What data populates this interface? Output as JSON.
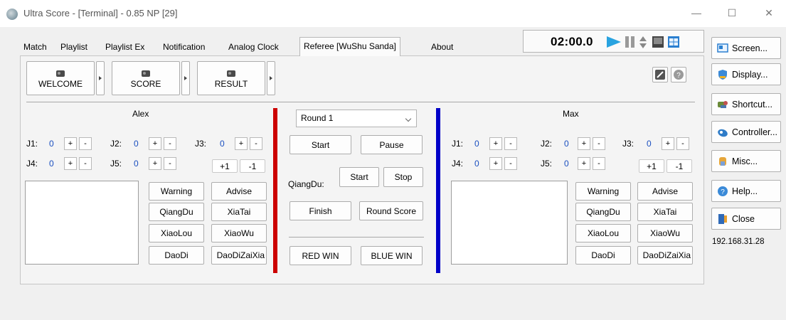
{
  "window": {
    "title": "Ultra Score - [Terminal] - 0.85 NP [29]",
    "minimize": "—",
    "maximize": "☐",
    "close": "✕"
  },
  "tabs": [
    "Match",
    "Playlist",
    "Playlist Ex",
    "Notification",
    "Analog Clock",
    "Referee [WuShu Sanda]",
    "About"
  ],
  "active_tab": "Referee [WuShu Sanda]",
  "timer": {
    "time": "02:00.0"
  },
  "top_buttons": {
    "welcome": "WELCOME",
    "score": "SCORE",
    "result": "RESULT"
  },
  "red": {
    "name": "Alex",
    "judges": [
      {
        "label": "J1:",
        "value": "0"
      },
      {
        "label": "J2:",
        "value": "0"
      },
      {
        "label": "J3:",
        "value": "0"
      },
      {
        "label": "J4:",
        "value": "0"
      },
      {
        "label": "J5:",
        "value": "0"
      }
    ],
    "plus_label": "+",
    "minus_label": "-",
    "plus_one": "+1",
    "minus_one": "-1",
    "actions": {
      "warning": "Warning",
      "advise": "Advise",
      "qiangdu": "QiangDu",
      "xiatai": "XiaTai",
      "xiaolou": "XiaoLou",
      "xiaowu": "XiaoWu",
      "daodi": "DaoDi",
      "daodizaixia": "DaoDiZaiXia"
    }
  },
  "blue": {
    "name": "Max",
    "judges": [
      {
        "label": "J1:",
        "value": "0"
      },
      {
        "label": "J2:",
        "value": "0"
      },
      {
        "label": "J3:",
        "value": "0"
      },
      {
        "label": "J4:",
        "value": "0"
      },
      {
        "label": "J5:",
        "value": "0"
      }
    ],
    "plus_label": "+",
    "minus_label": "-",
    "plus_one": "+1",
    "minus_one": "-1",
    "actions": {
      "warning": "Warning",
      "advise": "Advise",
      "qiangdu": "QiangDu",
      "xiatai": "XiaTai",
      "xiaolou": "XiaoLou",
      "xiaowu": "XiaoWu",
      "daodi": "DaoDi",
      "daodizaixia": "DaoDiZaiXia"
    }
  },
  "center": {
    "round_selected": "Round 1",
    "start": "Start",
    "pause": "Pause",
    "qiangdu_label": "QiangDu:",
    "qiangdu_start": "Start",
    "qiangdu_stop": "Stop",
    "finish": "Finish",
    "round_score": "Round Score",
    "red_win": "RED WIN",
    "blue_win": "BLUE WIN"
  },
  "sidebar": {
    "screen": "Screen...",
    "display": "Display...",
    "shortcut": "Shortcut...",
    "controller": "Controller...",
    "misc": "Misc...",
    "help": "Help...",
    "close": "Close",
    "ip": "192.168.31.28"
  },
  "colors": {
    "red_bar": "#cc0000",
    "blue_bar": "#0000c8",
    "score_value": "#1a4fc0",
    "play_icon": "#29a3e0"
  }
}
